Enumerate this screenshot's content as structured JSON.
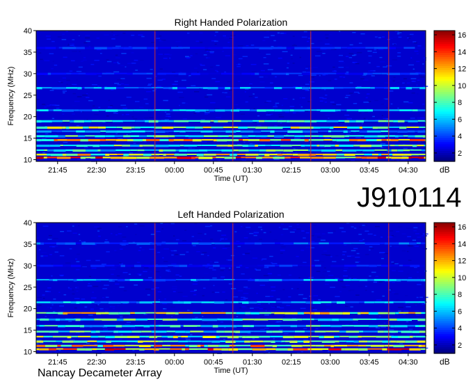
{
  "figure_id": "J910114",
  "footer_text": "Nancay Decameter Array",
  "colors": {
    "background": "#ffffff",
    "frame": "#000000"
  },
  "chart_data": [
    {
      "type": "heatmap",
      "title": "Right Handed Polarization",
      "xlabel": "Time (UT)",
      "ylabel": "Frequency (MHz)",
      "x_ticks": [
        "21:45",
        "22:30",
        "23:15",
        "00:00",
        "00:45",
        "01:30",
        "02:15",
        "03:00",
        "03:45",
        "04:30"
      ],
      "y_ticks": [
        10,
        15,
        20,
        25,
        30,
        35,
        40
      ],
      "ylim": [
        9.6,
        40
      ],
      "colorbar": {
        "label": "dB",
        "ticks": [
          2,
          4,
          6,
          8,
          10,
          12,
          14,
          16
        ],
        "range": [
          1,
          16.5
        ]
      },
      "bands_mhz": [
        {
          "freq": 10.5,
          "db": 15
        },
        {
          "freq": 11.2,
          "db": 12
        },
        {
          "freq": 12.2,
          "db": 9
        },
        {
          "freq": 13.3,
          "db": 10
        },
        {
          "freq": 14.6,
          "db": 13
        },
        {
          "freq": 15.5,
          "db": 9
        },
        {
          "freq": 16.6,
          "db": 7
        },
        {
          "freq": 17.5,
          "db": 11
        },
        {
          "freq": 19.0,
          "db": 9
        },
        {
          "freq": 21.5,
          "db": 7
        },
        {
          "freq": 26.7,
          "db": 6
        },
        {
          "freq": 30.0,
          "db": 4
        },
        {
          "freq": 36.0,
          "db": 4
        }
      ]
    },
    {
      "type": "heatmap",
      "title": "Left Handed Polarization",
      "xlabel": "Time (UT)",
      "ylabel": "Frequency (MHz)",
      "x_ticks": [
        "21:45",
        "22:30",
        "23:15",
        "00:00",
        "00:45",
        "01:30",
        "02:15",
        "03:00",
        "03:45",
        "04:30"
      ],
      "y_ticks": [
        10,
        15,
        20,
        25,
        30,
        35,
        40
      ],
      "ylim": [
        9.6,
        40
      ],
      "colorbar": {
        "label": "dB",
        "ticks": [
          2,
          4,
          6,
          8,
          10,
          12,
          14,
          16
        ],
        "range": [
          1,
          16.5
        ]
      },
      "bands_mhz": [
        {
          "freq": 10.6,
          "db": 15
        },
        {
          "freq": 11.4,
          "db": 13
        },
        {
          "freq": 12.4,
          "db": 10
        },
        {
          "freq": 13.5,
          "db": 11
        },
        {
          "freq": 14.7,
          "db": 9
        },
        {
          "freq": 16.0,
          "db": 8
        },
        {
          "freq": 17.5,
          "db": 9
        },
        {
          "freq": 19.0,
          "db": 12
        },
        {
          "freq": 21.5,
          "db": 7
        },
        {
          "freq": 26.7,
          "db": 6
        },
        {
          "freq": 30.0,
          "db": 4
        },
        {
          "freq": 35.2,
          "db": 5
        }
      ]
    }
  ]
}
